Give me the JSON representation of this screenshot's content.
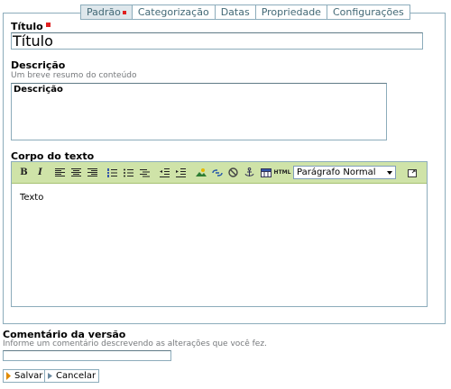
{
  "tabs": [
    {
      "label": "Padrão",
      "active": true,
      "required": true
    },
    {
      "label": "Categorização"
    },
    {
      "label": "Datas"
    },
    {
      "label": "Propriedade"
    },
    {
      "label": "Configurações"
    }
  ],
  "title_field": {
    "label": "Título",
    "value": "Título",
    "required": true
  },
  "description_field": {
    "label": "Descrição",
    "help": "Um breve resumo do conteúdo",
    "value": "Descrição"
  },
  "body_field": {
    "label": "Corpo do texto",
    "value": "Texto",
    "toolbar": {
      "bold": "B",
      "italic": "I",
      "html_button": "HTML",
      "format_select_value": "Parágrafo Normal",
      "icons": [
        "align-left-icon",
        "align-center-icon",
        "align-right-icon",
        "ordered-list-icon",
        "unordered-list-icon",
        "definition-list-icon",
        "outdent-icon",
        "indent-icon",
        "insert-image-icon",
        "insert-link-icon",
        "remove-link-icon",
        "anchor-icon",
        "insert-table-icon",
        "toggle-fullscreen-icon"
      ]
    }
  },
  "version_comment": {
    "label": "Comentário da versão",
    "help": "Informe um comentário descrevendo as alterações que você fez.",
    "value": ""
  },
  "buttons": {
    "save": "Salvar",
    "cancel": "Cancelar"
  },
  "colors": {
    "border": "#8cacbb",
    "tab_text": "#436976",
    "toolbar_bg": "#cfe3a8",
    "required": "#e02020",
    "help_text": "#76797c"
  }
}
